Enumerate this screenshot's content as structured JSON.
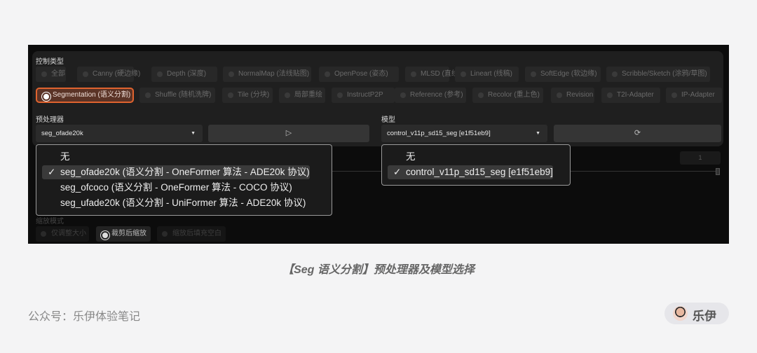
{
  "panel": {
    "control_type_label": "控制类型",
    "control_types_row1": [
      "全部",
      "Canny (硬边缘)",
      "Depth (深度)",
      "NormalMap (法线贴图)",
      "OpenPose (姿态)",
      "MLSD (直线)",
      "Lineart (线稿)",
      "SoftEdge (软边缘)",
      "Scribble/Sketch (涂鸦/草图)"
    ],
    "control_types_row2": [
      "Segmentation (语义分割)",
      "Shuffle (随机洗牌)",
      "Tile (分块)",
      "局部重绘",
      "InstructP2P",
      "Reference (参考)",
      "Recolor (重上色)",
      "Revision",
      "T2I-Adapter",
      "IP-Adapter"
    ],
    "selected_control_type": "Segmentation (语义分割)",
    "preprocessor_label": "预处理器",
    "preprocessor_value": "seg_ofade20k",
    "model_label": "模型",
    "model_value": "control_v11p_sd15_seg [e1f51eb9]",
    "run_icon": "play-icon",
    "refresh_icon": "refresh-icon",
    "number_value": "1",
    "preprocessor_options": [
      "无",
      "seg_ofade20k (语义分割 - OneFormer 算法 - ADE20k 协议)",
      "seg_ofcoco (语义分割 - OneFormer 算法 - COCO 协议)",
      "seg_ufade20k (语义分割 - UniFormer 算法 - ADE20k 协议)"
    ],
    "model_options": [
      "无",
      "control_v11p_sd15_seg [e1f51eb9]"
    ],
    "check_mark": "✓",
    "resize_mode_label": "缩放模式",
    "resize_modes": [
      "仅调整大小",
      "裁剪后缩放",
      "缩放后填充空白"
    ],
    "selected_resize_mode": "裁剪后缩放"
  },
  "caption": "【Seg 语义分割】预处理器及模型选择",
  "footer": {
    "account": "公众号：乐伊体验笔记",
    "author": "乐伊"
  },
  "colors": {
    "accent": "#e0632f"
  }
}
